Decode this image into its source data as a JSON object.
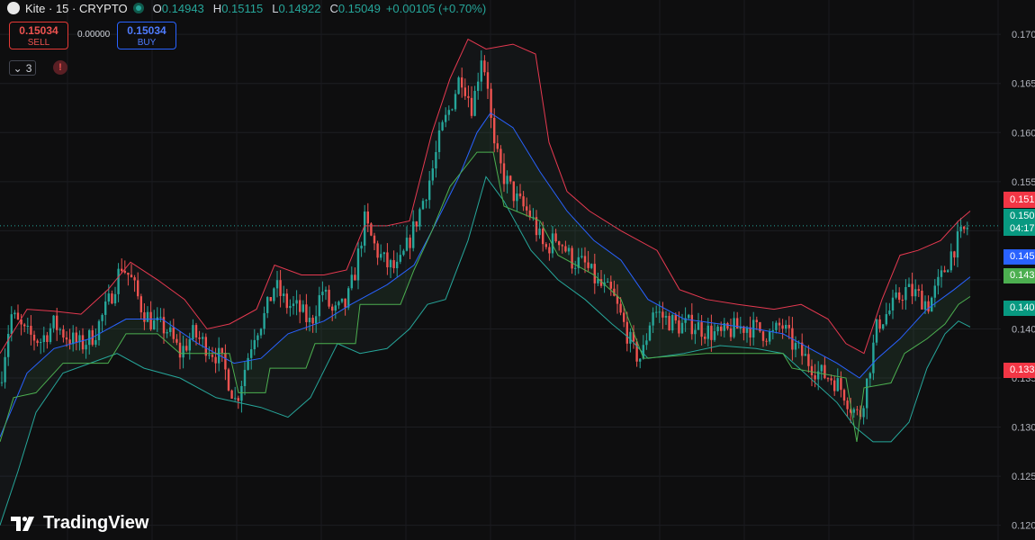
{
  "header": {
    "symbol": "Kite · 15 · CRYPTO",
    "open_label": "O",
    "open": "0.14943",
    "high_label": "H",
    "high": "0.15115",
    "low_label": "L",
    "low": "0.14922",
    "close_label": "C",
    "close": "0.15049",
    "change": "+0.00105 (+0.70%)"
  },
  "trade": {
    "sell_price": "0.15034",
    "sell_label": "SELL",
    "spread": "0.00000",
    "buy_price": "0.15034",
    "buy_label": "BUY"
  },
  "indicators": {
    "count": "3",
    "warning": "!"
  },
  "brand": {
    "name": "TradingView"
  },
  "price_tags": {
    "upper_band": "0.151",
    "last_price": "0.150",
    "countdown": "04:17",
    "ma_blue": "0.145",
    "ma_green": "0.143",
    "lower_band": "0.140",
    "lowest": "0.133"
  },
  "colors": {
    "up": "#26a69a",
    "down": "#ef5350",
    "upper_band": "#e53950",
    "lower_band": "#26a69a",
    "ma": "#2962ff",
    "donchian": "#4caf50"
  },
  "chart_data": {
    "type": "candlestick",
    "symbol": "Kite",
    "interval": "15",
    "y_ticks": [
      0.12,
      0.125,
      0.13,
      0.135,
      0.14,
      0.145,
      0.15,
      0.155,
      0.16,
      0.165,
      0.17
    ],
    "y_tick_labels": [
      "0.120",
      "0.125",
      "0.130",
      "0.135",
      "0.140",
      "0.145",
      "0.150",
      "0.155",
      "0.160",
      "0.165",
      "0.170"
    ],
    "ylim": [
      0.1185,
      0.1735
    ],
    "grid": true,
    "close_path": [
      [
        0,
        0.1345
      ],
      [
        12,
        0.1415
      ],
      [
        28,
        0.1395
      ],
      [
        45,
        0.1388
      ],
      [
        60,
        0.1405
      ],
      [
        75,
        0.1392
      ],
      [
        90,
        0.1383
      ],
      [
        105,
        0.1395
      ],
      [
        120,
        0.1425
      ],
      [
        135,
        0.1465
      ],
      [
        145,
        0.1452
      ],
      [
        158,
        0.142
      ],
      [
        170,
        0.1405
      ],
      [
        185,
        0.14
      ],
      [
        200,
        0.1375
      ],
      [
        215,
        0.1395
      ],
      [
        230,
        0.1382
      ],
      [
        245,
        0.137
      ],
      [
        255,
        0.1345
      ],
      [
        262,
        0.1325
      ],
      [
        272,
        0.136
      ],
      [
        282,
        0.1395
      ],
      [
        295,
        0.1415
      ],
      [
        305,
        0.1445
      ],
      [
        318,
        0.1425
      ],
      [
        332,
        0.142
      ],
      [
        345,
        0.1405
      ],
      [
        358,
        0.144
      ],
      [
        370,
        0.1415
      ],
      [
        385,
        0.1425
      ],
      [
        395,
        0.146
      ],
      [
        405,
        0.151
      ],
      [
        418,
        0.148
      ],
      [
        430,
        0.1465
      ],
      [
        442,
        0.146
      ],
      [
        455,
        0.149
      ],
      [
        468,
        0.1525
      ],
      [
        480,
        0.156
      ],
      [
        490,
        0.16
      ],
      [
        500,
        0.1625
      ],
      [
        512,
        0.166
      ],
      [
        525,
        0.1625
      ],
      [
        535,
        0.168
      ],
      [
        542,
        0.165
      ],
      [
        548,
        0.1585
      ],
      [
        560,
        0.1555
      ],
      [
        575,
        0.153
      ],
      [
        590,
        0.1515
      ],
      [
        605,
        0.148
      ],
      [
        620,
        0.1495
      ],
      [
        635,
        0.147
      ],
      [
        650,
        0.1465
      ],
      [
        665,
        0.1445
      ],
      [
        680,
        0.1435
      ],
      [
        695,
        0.14
      ],
      [
        705,
        0.1375
      ],
      [
        713,
        0.137
      ],
      [
        725,
        0.142
      ],
      [
        740,
        0.141
      ],
      [
        755,
        0.1403
      ],
      [
        770,
        0.1405
      ],
      [
        785,
        0.1398
      ],
      [
        800,
        0.1393
      ],
      [
        815,
        0.14
      ],
      [
        830,
        0.1403
      ],
      [
        845,
        0.1398
      ],
      [
        858,
        0.1393
      ],
      [
        868,
        0.1405
      ],
      [
        880,
        0.1385
      ],
      [
        895,
        0.137
      ],
      [
        910,
        0.1355
      ],
      [
        925,
        0.135
      ],
      [
        938,
        0.1335
      ],
      [
        946,
        0.132
      ],
      [
        955,
        0.131
      ],
      [
        963,
        0.1345
      ],
      [
        975,
        0.1405
      ],
      [
        990,
        0.142
      ],
      [
        1005,
        0.144
      ],
      [
        1018,
        0.1435
      ],
      [
        1032,
        0.1425
      ],
      [
        1045,
        0.145
      ],
      [
        1058,
        0.148
      ],
      [
        1068,
        0.1495
      ],
      [
        1076,
        0.1505
      ]
    ],
    "upper_band": [
      [
        0,
        0.1375
      ],
      [
        30,
        0.142
      ],
      [
        60,
        0.1418
      ],
      [
        90,
        0.1415
      ],
      [
        120,
        0.144
      ],
      [
        145,
        0.1468
      ],
      [
        175,
        0.145
      ],
      [
        205,
        0.143
      ],
      [
        230,
        0.14
      ],
      [
        255,
        0.1405
      ],
      [
        285,
        0.142
      ],
      [
        305,
        0.1465
      ],
      [
        335,
        0.1455
      ],
      [
        360,
        0.1455
      ],
      [
        385,
        0.146
      ],
      [
        405,
        0.1505
      ],
      [
        430,
        0.1505
      ],
      [
        455,
        0.151
      ],
      [
        480,
        0.16
      ],
      [
        500,
        0.1655
      ],
      [
        520,
        0.1695
      ],
      [
        540,
        0.1685
      ],
      [
        570,
        0.169
      ],
      [
        595,
        0.168
      ],
      [
        610,
        0.159
      ],
      [
        630,
        0.154
      ],
      [
        655,
        0.152
      ],
      [
        690,
        0.15
      ],
      [
        730,
        0.148
      ],
      [
        755,
        0.144
      ],
      [
        785,
        0.143
      ],
      [
        820,
        0.1425
      ],
      [
        860,
        0.142
      ],
      [
        890,
        0.1425
      ],
      [
        920,
        0.141
      ],
      [
        940,
        0.1385
      ],
      [
        960,
        0.1375
      ],
      [
        980,
        0.143
      ],
      [
        1000,
        0.1475
      ],
      [
        1020,
        0.148
      ],
      [
        1045,
        0.149
      ],
      [
        1065,
        0.151
      ],
      [
        1078,
        0.152
      ]
    ],
    "lower_band": [
      [
        0,
        0.12
      ],
      [
        20,
        0.1255
      ],
      [
        40,
        0.1315
      ],
      [
        70,
        0.1355
      ],
      [
        100,
        0.1365
      ],
      [
        130,
        0.1375
      ],
      [
        160,
        0.136
      ],
      [
        200,
        0.135
      ],
      [
        240,
        0.133
      ],
      [
        265,
        0.1325
      ],
      [
        290,
        0.132
      ],
      [
        320,
        0.131
      ],
      [
        345,
        0.133
      ],
      [
        375,
        0.1385
      ],
      [
        400,
        0.1375
      ],
      [
        430,
        0.138
      ],
      [
        455,
        0.14
      ],
      [
        475,
        0.1425
      ],
      [
        495,
        0.143
      ],
      [
        520,
        0.149
      ],
      [
        540,
        0.1555
      ],
      [
        560,
        0.153
      ],
      [
        590,
        0.148
      ],
      [
        620,
        0.145
      ],
      [
        650,
        0.143
      ],
      [
        680,
        0.1405
      ],
      [
        700,
        0.139
      ],
      [
        720,
        0.137
      ],
      [
        760,
        0.1375
      ],
      [
        800,
        0.1383
      ],
      [
        840,
        0.138
      ],
      [
        870,
        0.1375
      ],
      [
        900,
        0.135
      ],
      [
        930,
        0.1325
      ],
      [
        950,
        0.13
      ],
      [
        970,
        0.1285
      ],
      [
        990,
        0.1285
      ],
      [
        1010,
        0.1305
      ],
      [
        1030,
        0.136
      ],
      [
        1050,
        0.1395
      ],
      [
        1065,
        0.1408
      ],
      [
        1078,
        0.1402
      ]
    ],
    "moving_average": [
      [
        0,
        0.129
      ],
      [
        30,
        0.1355
      ],
      [
        60,
        0.138
      ],
      [
        100,
        0.139
      ],
      [
        140,
        0.141
      ],
      [
        180,
        0.141
      ],
      [
        220,
        0.1385
      ],
      [
        260,
        0.1365
      ],
      [
        290,
        0.137
      ],
      [
        320,
        0.1395
      ],
      [
        360,
        0.1408
      ],
      [
        390,
        0.1425
      ],
      [
        430,
        0.1445
      ],
      [
        460,
        0.1465
      ],
      [
        480,
        0.15
      ],
      [
        510,
        0.1555
      ],
      [
        530,
        0.16
      ],
      [
        545,
        0.162
      ],
      [
        570,
        0.1605
      ],
      [
        600,
        0.156
      ],
      [
        630,
        0.152
      ],
      [
        660,
        0.149
      ],
      [
        690,
        0.147
      ],
      [
        720,
        0.143
      ],
      [
        760,
        0.141
      ],
      [
        800,
        0.1405
      ],
      [
        840,
        0.14
      ],
      [
        870,
        0.1395
      ],
      [
        900,
        0.138
      ],
      [
        930,
        0.1365
      ],
      [
        955,
        0.135
      ],
      [
        975,
        0.137
      ],
      [
        1000,
        0.139
      ],
      [
        1030,
        0.142
      ],
      [
        1060,
        0.144
      ],
      [
        1078,
        0.1453
      ]
    ],
    "donchian_mid": [
      [
        0,
        0.1285
      ],
      [
        15,
        0.133
      ],
      [
        40,
        0.1335
      ],
      [
        70,
        0.1365
      ],
      [
        120,
        0.1365
      ],
      [
        140,
        0.1395
      ],
      [
        175,
        0.1395
      ],
      [
        200,
        0.1375
      ],
      [
        255,
        0.1375
      ],
      [
        265,
        0.1335
      ],
      [
        295,
        0.1335
      ],
      [
        300,
        0.136
      ],
      [
        340,
        0.136
      ],
      [
        350,
        0.1385
      ],
      [
        395,
        0.1385
      ],
      [
        400,
        0.1425
      ],
      [
        445,
        0.1425
      ],
      [
        460,
        0.146
      ],
      [
        480,
        0.15
      ],
      [
        500,
        0.1545
      ],
      [
        530,
        0.158
      ],
      [
        548,
        0.158
      ],
      [
        560,
        0.1525
      ],
      [
        600,
        0.151
      ],
      [
        620,
        0.1475
      ],
      [
        660,
        0.1455
      ],
      [
        690,
        0.143
      ],
      [
        715,
        0.137
      ],
      [
        785,
        0.1375
      ],
      [
        870,
        0.1375
      ],
      [
        880,
        0.136
      ],
      [
        940,
        0.135
      ],
      [
        952,
        0.1285
      ],
      [
        960,
        0.134
      ],
      [
        990,
        0.1345
      ],
      [
        1005,
        0.1375
      ],
      [
        1030,
        0.139
      ],
      [
        1050,
        0.1405
      ],
      [
        1065,
        0.1425
      ],
      [
        1078,
        0.1433
      ]
    ]
  }
}
